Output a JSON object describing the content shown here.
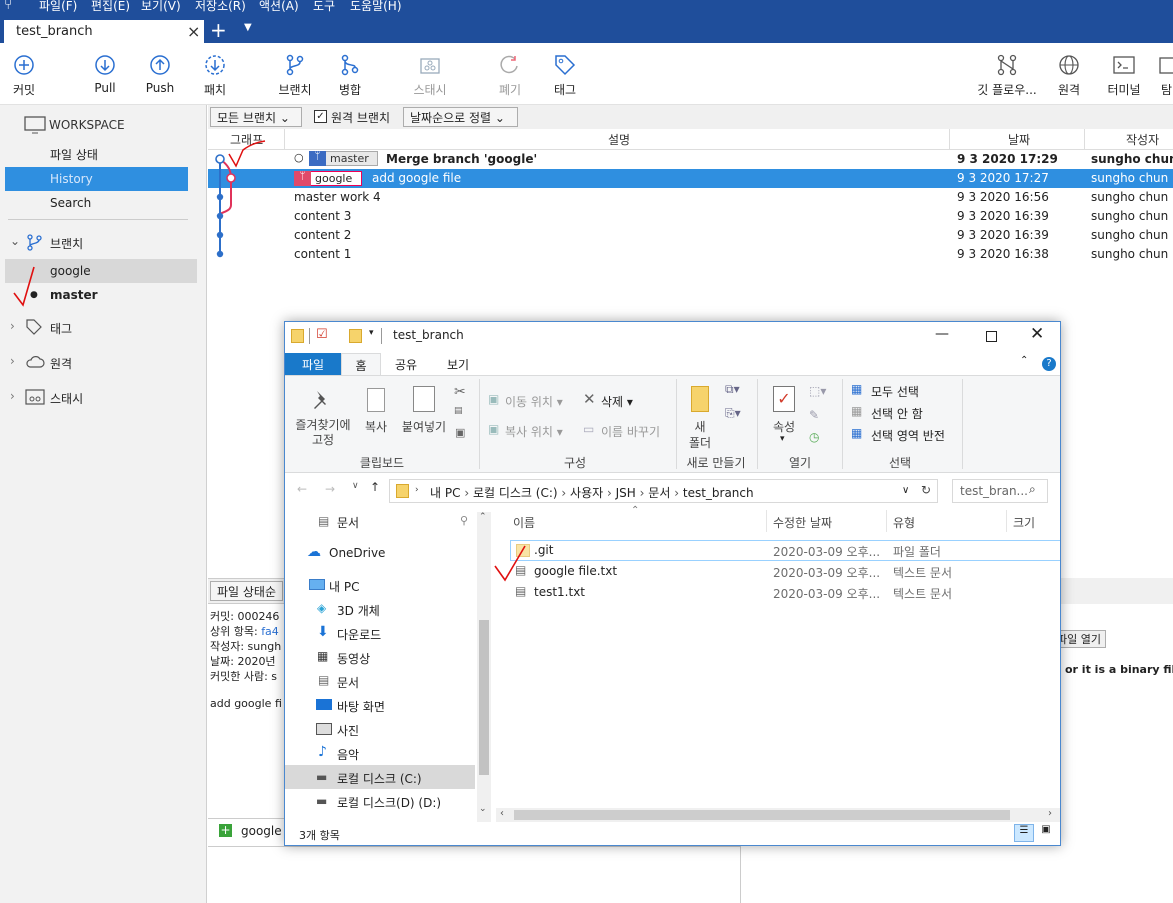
{
  "menu": {
    "items": [
      "파일(F)",
      "편집(E)",
      "보기(V)",
      "저장소(R)",
      "액션(A)",
      "도구",
      "도움말(H)"
    ]
  },
  "tab": {
    "title": "test_branch",
    "close": "×"
  },
  "toolbar": {
    "commit": "커밋",
    "pull": "Pull",
    "push": "Push",
    "patch": "패치",
    "branch": "브랜치",
    "merge": "병합",
    "stash": "스태시",
    "discard": "폐기",
    "tag": "태그",
    "gitflow": "깃 플로우...",
    "remote": "원격",
    "terminal": "터미널",
    "explorer": "탐"
  },
  "sidebar": {
    "workspace": "WORKSPACE",
    "file_status": "파일 상태",
    "history": "History",
    "search": "Search",
    "branches": "브랜치",
    "branch_google": "google",
    "branch_master": "master",
    "tags": "태그",
    "remotes": "원격",
    "stashes": "스태시"
  },
  "filters": {
    "branches": "모든 브랜치",
    "remote_label": "원격 브랜치",
    "remote_checked": true,
    "sort": "날짜순으로 정렬"
  },
  "columns": {
    "graph": "그래프",
    "desc": "설명",
    "date": "날짜",
    "author": "작성자"
  },
  "commits": [
    {
      "branch": "master",
      "msg": "Merge branch 'google'",
      "date": "9 3 2020 17:29",
      "author": "sungho chun -"
    },
    {
      "branch": "google",
      "msg": "add google file",
      "date": "9 3 2020 17:27",
      "author": "sungho chun <"
    },
    {
      "branch": "",
      "msg": "master work 4",
      "date": "9 3 2020 16:56",
      "author": "sungho chun <"
    },
    {
      "branch": "",
      "msg": "content 3",
      "date": "9 3 2020 16:39",
      "author": "sungho chun <"
    },
    {
      "branch": "",
      "msg": "content 2",
      "date": "9 3 2020 16:39",
      "author": "sungho chun <"
    },
    {
      "branch": "",
      "msg": "content 1",
      "date": "9 3 2020 16:38",
      "author": "sungho chun <"
    }
  ],
  "details": {
    "tab": "파일 상태순",
    "commit": "커밋: 000246",
    "parents_label": "상위 항목:",
    "parents_val": "fa4",
    "author": "작성자: sungh",
    "date": "날짜: 2020년",
    "committer": "커밋한 사람: s",
    "message": "add google fi",
    "file": "google",
    "open_file": "파일 열기",
    "binary_msg": "or it is a binary file"
  },
  "explorer": {
    "title": "test_branch",
    "tabs": [
      "파일",
      "홈",
      "공유",
      "보기"
    ],
    "ribbon": {
      "pin": "즐겨찾기에\n고정",
      "copy": "복사",
      "paste": "붙여넣기",
      "clipboard": "클립보드",
      "moveto": "이동 위치",
      "delete": "삭제",
      "copyto": "복사 위치",
      "rename": "이름 바꾸기",
      "organize": "구성",
      "newfolder_top": "새",
      "newfolder_bot": "폴더",
      "new": "새로 만들기",
      "props": "속성",
      "open": "열기",
      "selectall": "모두 선택",
      "selectnone": "선택 안 함",
      "invert": "선택 영역 반전",
      "select": "선택"
    },
    "path": [
      "내 PC",
      "로컬 디스크 (C:)",
      "사용자",
      "JSH",
      "문서",
      "test_branch"
    ],
    "search_placeholder": "test_bran...",
    "nav": [
      "문서",
      "OneDrive",
      "내 PC",
      "3D 개체",
      "다운로드",
      "동영상",
      "문서",
      "바탕 화면",
      "사진",
      "음악",
      "로컬 디스크 (C:)",
      "로컬 디스크(D) (D:)"
    ],
    "cols": {
      "name": "이름",
      "modified": "수정한 날짜",
      "type": "유형",
      "size": "크기"
    },
    "files": [
      {
        "name": ".git",
        "modified": "2020-03-09 오후...",
        "type": "파일 폴더"
      },
      {
        "name": "google file.txt",
        "modified": "2020-03-09 오후...",
        "type": "텍스트 문서"
      },
      {
        "name": "test1.txt",
        "modified": "2020-03-09 오후...",
        "type": "텍스트 문서"
      }
    ],
    "status": "3개 항목"
  }
}
